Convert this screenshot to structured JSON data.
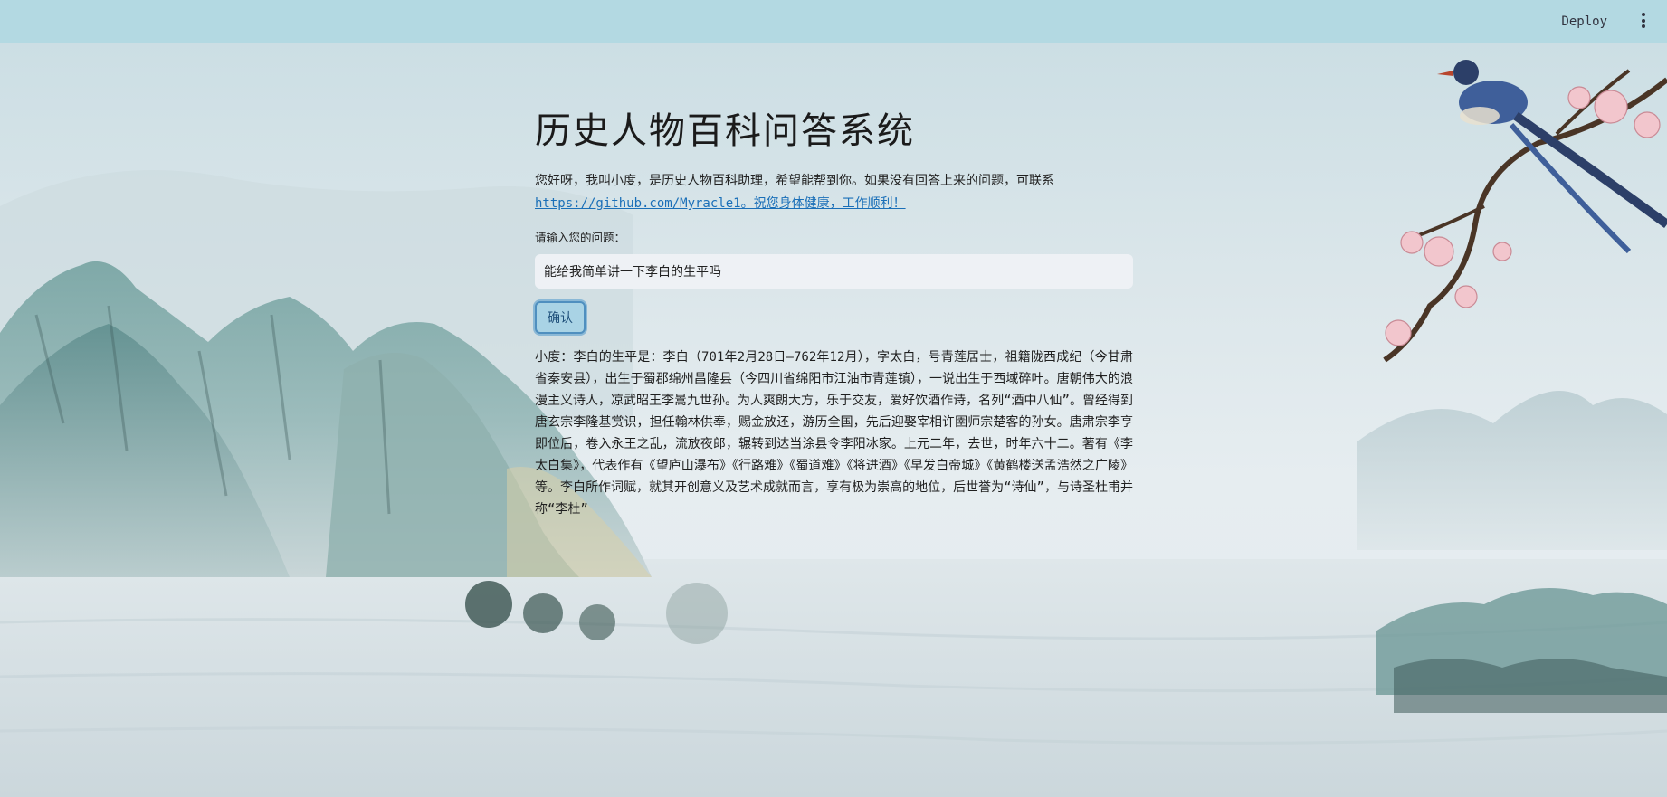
{
  "header": {
    "deploy_label": "Deploy",
    "menu_icon": "vertical-ellipsis-icon"
  },
  "main": {
    "title": "历史人物百科问答系统",
    "intro_text": "您好呀，我叫小度，是历史人物百科助理，希望能帮到你。如果没有回答上来的问题，可联系",
    "intro_link": "https://github.com/Myracle1。祝您身体健康，工作顺利！",
    "question_label": "请输入您的问题：",
    "question_value": "能给我简单讲一下李白的生平吗",
    "confirm_label": "确认",
    "answer": "小度：李白的生平是：李白（701年2月28日—762年12月），字太白，号青莲居士，祖籍陇西成纪（今甘肃省秦安县），出生于蜀郡绵州昌隆县（今四川省绵阳市江油市青莲镇），一说出生于西域碎叶。唐朝伟大的浪漫主义诗人，凉武昭王李暠九世孙。为人爽朗大方，乐于交友，爱好饮酒作诗，名列“酒中八仙”。曾经得到唐玄宗李隆基赏识，担任翰林供奉，赐金放还，游历全国，先后迎娶宰相许圉师宗楚客的孙女。唐肃宗李亨即位后，卷入永王之乱，流放夜郎，辗转到达当涂县令李阳冰家。上元二年，去世，时年六十二。著有《李太白集》，代表作有《望庐山瀑布》《行路难》《蜀道难》《将进酒》《早发白帝城》《黄鹤楼送孟浩然之广陵》等。李白所作词赋，就其开创意义及艺术成就而言，享有极为崇高的地位，后世誉为“诗仙”，与诗圣杜甫并称“李杜”"
  },
  "colors": {
    "topbar": "#b3d9e2",
    "link": "#1a6fb8",
    "button_bg": "#a9d3e5",
    "button_border": "#4f8fbf"
  }
}
